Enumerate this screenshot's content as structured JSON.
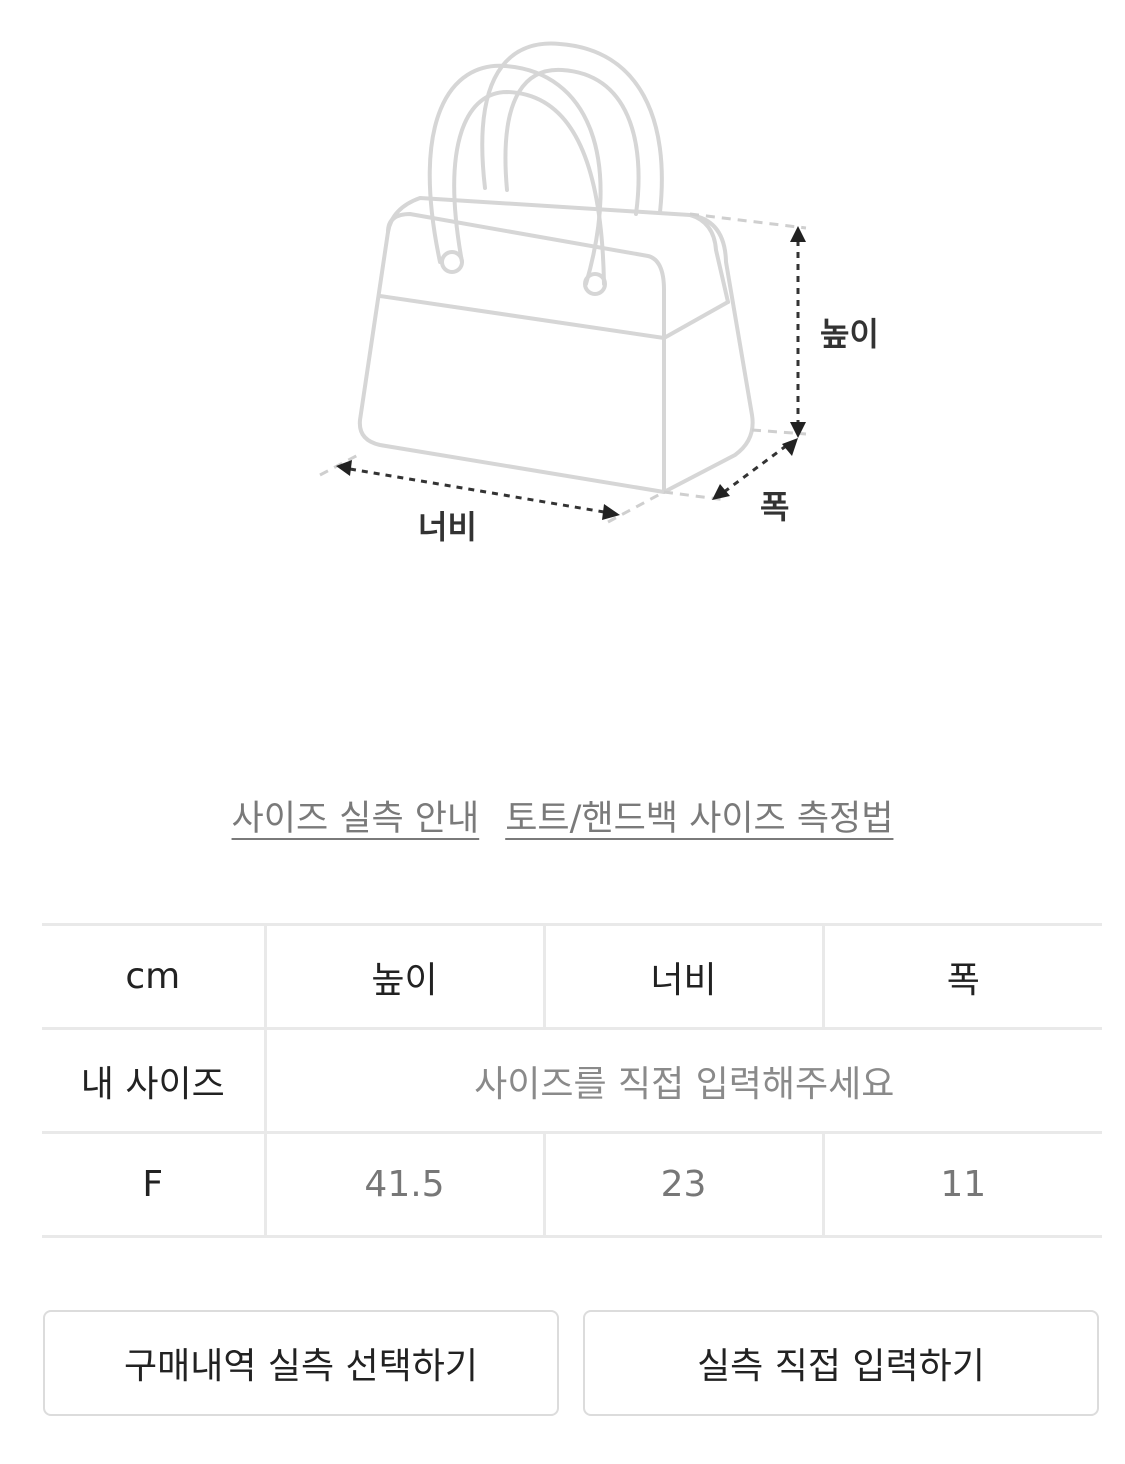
{
  "diagram": {
    "height_label": "높이",
    "width_label": "너비",
    "depth_label": "폭"
  },
  "links": {
    "size_guide": "사이즈 실측 안내",
    "tote_method": "토트/핸드백 사이즈 측정법"
  },
  "table": {
    "unit": "cm",
    "headers": [
      "높이",
      "너비",
      "폭"
    ],
    "my_size_label": "내 사이즈",
    "my_size_placeholder": "사이즈를 직접 입력해주세요",
    "rows": [
      {
        "size": "F",
        "values": [
          "41.5",
          "23",
          "11"
        ]
      }
    ]
  },
  "buttons": {
    "purchase_history": "구매내역 실측 선택하기",
    "direct_input": "실측 직접 입력하기"
  }
}
